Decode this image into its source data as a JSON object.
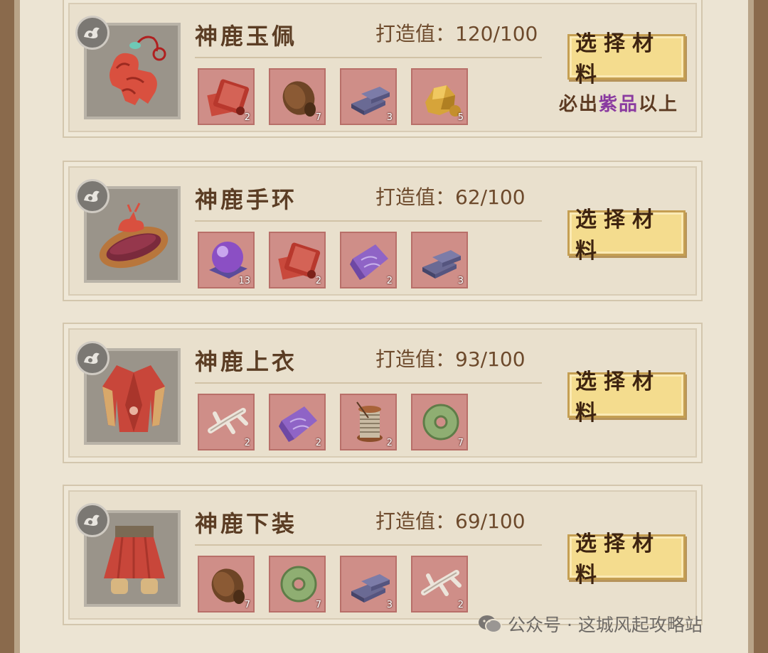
{
  "colors": {
    "card_bg": "#e9e0cd",
    "slot_bg": "#cf8e88",
    "button_bg": "#f4dc8e",
    "title_text": "#5b3d24",
    "purple_highlight": "#8a3aa0"
  },
  "cards": [
    {
      "name": "神鹿玉佩",
      "forge_label": "打造值：",
      "forge_value": "120/100",
      "button_label": "选择材料",
      "note_prefix": "必出",
      "note_highlight": "紫品",
      "note_suffix": "以上",
      "icon": "deer-jade-pendant-icon",
      "materials": [
        {
          "icon": "red-cloth-bolt-icon",
          "qty": "2"
        },
        {
          "icon": "brown-fur-icon",
          "qty": "7"
        },
        {
          "icon": "iron-ingot-icon",
          "qty": "3"
        },
        {
          "icon": "gold-ore-icon",
          "qty": "5"
        }
      ]
    },
    {
      "name": "神鹿手环",
      "forge_label": "打造值：",
      "forge_value": "62/100",
      "button_label": "选择材料",
      "icon": "deer-bracelet-icon",
      "materials": [
        {
          "icon": "purple-orb-icon",
          "qty": "13"
        },
        {
          "icon": "red-cloth-bolt-icon",
          "qty": "2"
        },
        {
          "icon": "purple-silk-icon",
          "qty": "2"
        },
        {
          "icon": "iron-ingot-icon",
          "qty": "3"
        }
      ]
    },
    {
      "name": "神鹿上衣",
      "forge_label": "打造值：",
      "forge_value": "93/100",
      "button_label": "选择材料",
      "icon": "red-robe-icon",
      "materials": [
        {
          "icon": "antler-bone-icon",
          "qty": "2"
        },
        {
          "icon": "purple-silk-icon",
          "qty": "2"
        },
        {
          "icon": "thread-spool-icon",
          "qty": "2"
        },
        {
          "icon": "jade-disc-icon",
          "qty": "7"
        }
      ]
    },
    {
      "name": "神鹿下装",
      "forge_label": "打造值：",
      "forge_value": "69/100",
      "button_label": "选择材料",
      "icon": "red-skirt-icon",
      "materials": [
        {
          "icon": "brown-fur-icon",
          "qty": "7"
        },
        {
          "icon": "jade-disc-icon",
          "qty": "7"
        },
        {
          "icon": "iron-ingot-icon",
          "qty": "3"
        },
        {
          "icon": "antler-bone-icon",
          "qty": "2"
        }
      ]
    }
  ],
  "watermark": "公众号 · 这城风起攻略站"
}
